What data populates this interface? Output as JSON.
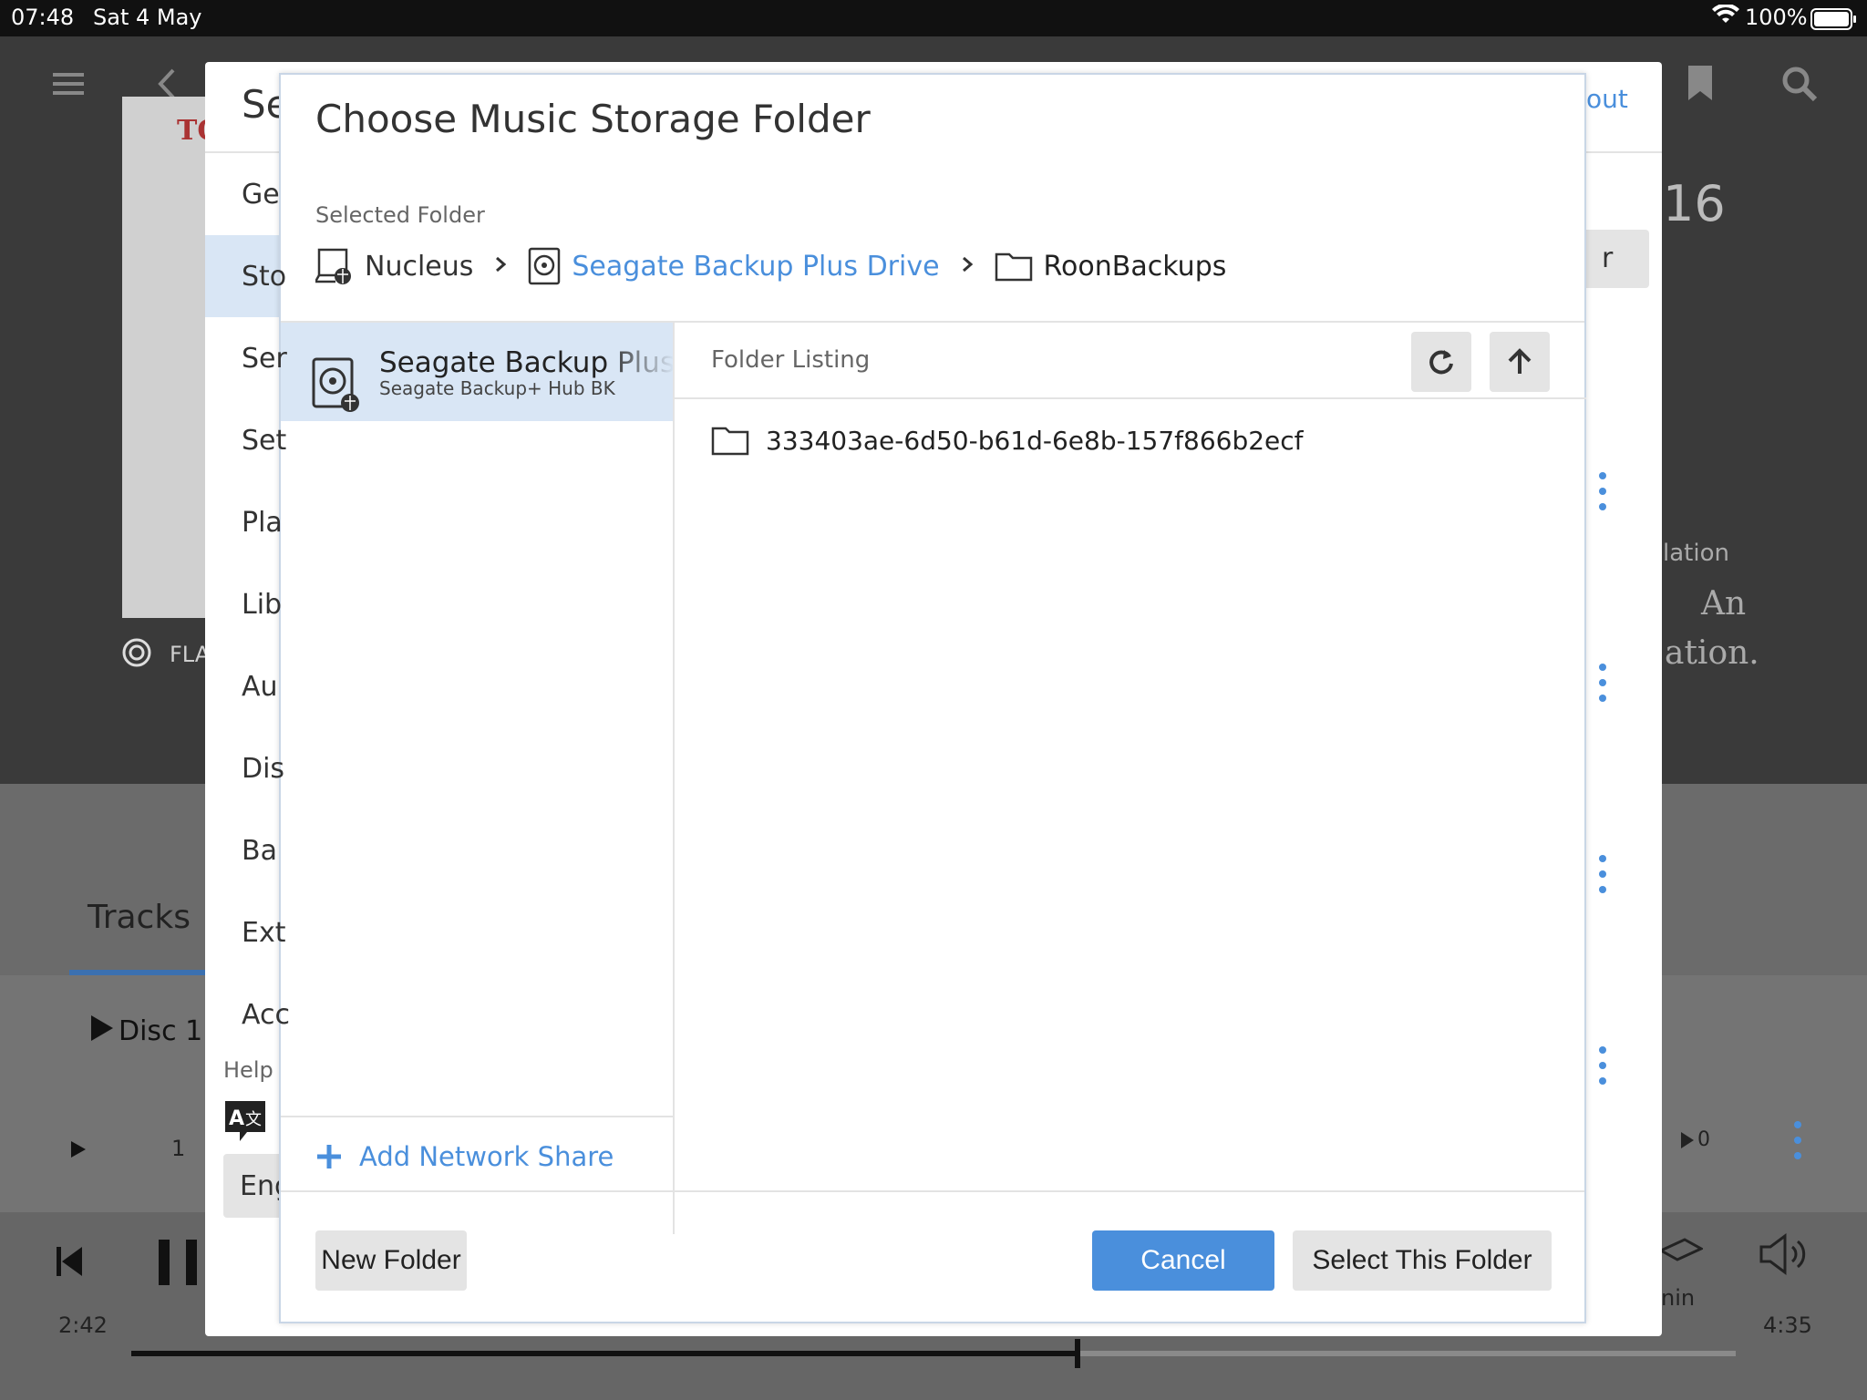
{
  "statusbar": {
    "time": "07:48",
    "date": "Sat 4 May",
    "battery": "100%"
  },
  "background": {
    "tracks_tab": "Tracks",
    "disc_label": "Disc 1",
    "track_number": "1",
    "play_count": "0",
    "time_elapsed": "2:42",
    "time_total": "4:35",
    "year_fragment": "16",
    "text_fragment_1": "lation",
    "text_fragment_2": "An",
    "text_fragment_3": "ation.",
    "format_fragment": "FLA",
    "button_fragment": "r",
    "zone_fragment": "nin",
    "album_art_fragment": "TO",
    "progress": 0.59
  },
  "settings": {
    "title_fragment": "Se",
    "about_link": "out",
    "items": [
      "Ge",
      "Sto",
      "Ser",
      "Set",
      "Pla",
      "Lib",
      "Au",
      "Dis",
      "Ba",
      "Ext",
      "Acc"
    ],
    "help_label": "Help",
    "language_value": "Eng"
  },
  "dialog": {
    "title": "Choose Music Storage Folder",
    "selected_folder_label": "Selected Folder",
    "breadcrumb": {
      "host": "Nucleus",
      "drive": "Seagate Backup Plus Drive",
      "folder": "RoonBackups"
    },
    "drives": [
      {
        "name": "Seagate Backup Plus Drive",
        "subtitle": "Seagate Backup+ Hub BK"
      }
    ],
    "folder_listing_label": "Folder Listing",
    "folders": [
      "333403ae-6d50-b61d-6e8b-157f866b2ecf"
    ],
    "add_network_share": "Add Network Share",
    "new_folder": "New Folder",
    "cancel": "Cancel",
    "select_folder": "Select This Folder"
  },
  "colors": {
    "accent": "#4a8fdc",
    "selected_bg": "#d9e6f5",
    "button_grey": "#e4e4e4"
  }
}
